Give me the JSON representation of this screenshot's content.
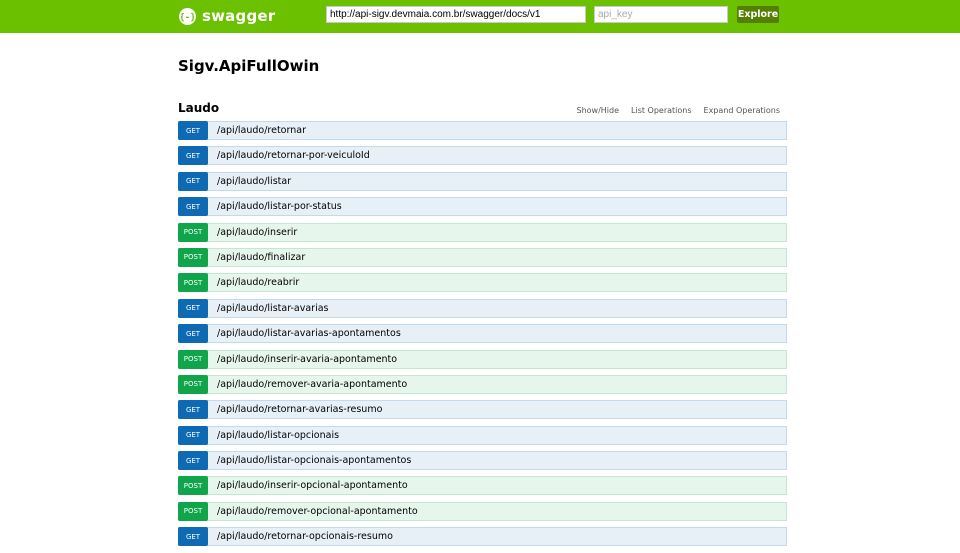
{
  "header": {
    "logo_text": "swagger",
    "logo_icon": "swagger-braces-icon",
    "url_value": "http://api-sigv.devmaia.com.br/swagger/docs/v1",
    "api_key_placeholder": "api_key",
    "explore_label": "Explore",
    "brand_color": "#6bc100"
  },
  "info": {
    "title": "Sigv.ApiFullOwin"
  },
  "resource": {
    "name": "Laudo",
    "options": [
      "Show/Hide",
      "List Operations",
      "Expand Operations"
    ],
    "operations": [
      {
        "method": "GET",
        "path": "/api/laudo/retornar"
      },
      {
        "method": "GET",
        "path": "/api/laudo/retornar-por-veiculoId"
      },
      {
        "method": "GET",
        "path": "/api/laudo/listar"
      },
      {
        "method": "GET",
        "path": "/api/laudo/listar-por-status"
      },
      {
        "method": "POST",
        "path": "/api/laudo/inserir"
      },
      {
        "method": "POST",
        "path": "/api/laudo/finalizar"
      },
      {
        "method": "POST",
        "path": "/api/laudo/reabrir"
      },
      {
        "method": "GET",
        "path": "/api/laudo/listar-avarias"
      },
      {
        "method": "GET",
        "path": "/api/laudo/listar-avarias-apontamentos"
      },
      {
        "method": "POST",
        "path": "/api/laudo/inserir-avaria-apontamento"
      },
      {
        "method": "POST",
        "path": "/api/laudo/remover-avaria-apontamento"
      },
      {
        "method": "GET",
        "path": "/api/laudo/retornar-avarias-resumo"
      },
      {
        "method": "GET",
        "path": "/api/laudo/listar-opcionais"
      },
      {
        "method": "GET",
        "path": "/api/laudo/listar-opcionais-apontamentos"
      },
      {
        "method": "POST",
        "path": "/api/laudo/inserir-opcional-apontamento"
      },
      {
        "method": "POST",
        "path": "/api/laudo/remover-opcional-apontamento"
      },
      {
        "method": "GET",
        "path": "/api/laudo/retornar-opcionais-resumo"
      }
    ]
  },
  "colors": {
    "get_badge": "#0f6ab4",
    "post_badge": "#10a54a",
    "get_row": "#e7f0f7",
    "post_row": "#e7f6ec",
    "explore_button": "#547f00"
  }
}
